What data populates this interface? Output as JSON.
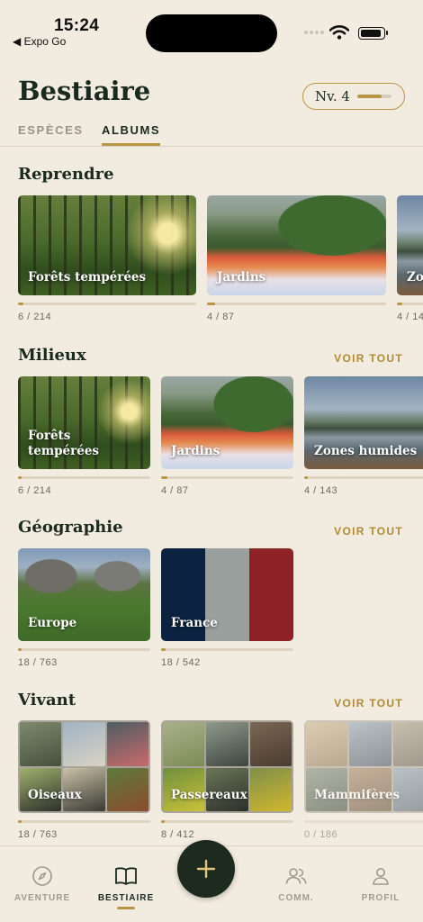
{
  "status": {
    "time": "15:24",
    "back_label": "◀ Expo Go"
  },
  "header": {
    "title": "Bestiaire",
    "level_label": "Nv. 4",
    "level_progress": 0.7
  },
  "tabs": [
    {
      "label": "ESPÈCES"
    },
    {
      "label": "ALBUMS"
    }
  ],
  "sections": {
    "reprendre": {
      "title": "Reprendre",
      "items": [
        {
          "label": "Forêts tempérées",
          "count": "6 / 214",
          "progress": 0.028
        },
        {
          "label": "Jardins",
          "count": "4 / 87",
          "progress": 0.046
        },
        {
          "label": "Zo",
          "count": "4 / 14",
          "progress": 0.028
        }
      ]
    },
    "milieux": {
      "title": "Milieux",
      "see_all": "VOIR TOUT",
      "items": [
        {
          "label": "Forêts tempérées",
          "count": "6 / 214",
          "progress": 0.028
        },
        {
          "label": "Jardins",
          "count": "4 / 87",
          "progress": 0.046
        },
        {
          "label": "Zones humides",
          "count": "4 / 143",
          "progress": 0.028
        }
      ]
    },
    "geographie": {
      "title": "Géographie",
      "see_all": "VOIR TOUT",
      "items": [
        {
          "label": "Europe",
          "count": "18 / 763",
          "progress": 0.024
        },
        {
          "label": "France",
          "count": "18 / 542",
          "progress": 0.033
        }
      ]
    },
    "vivant": {
      "title": "Vivant",
      "see_all": "VOIR TOUT",
      "items": [
        {
          "label": "Oiseaux",
          "count": "18 / 763",
          "progress": 0.024
        },
        {
          "label": "Passereaux",
          "count": "8 / 412",
          "progress": 0.019
        },
        {
          "label": "Mammifères",
          "count": "0 / 186",
          "progress": 0
        }
      ]
    }
  },
  "bottom_nav": [
    {
      "label": "AVENTURE",
      "icon": "compass-icon"
    },
    {
      "label": "BESTIAIRE",
      "icon": "book-icon"
    },
    {
      "label": "COMM.",
      "icon": "users-icon"
    },
    {
      "label": "PROFIL",
      "icon": "user-icon"
    }
  ],
  "colors": {
    "accent": "#b89545",
    "background": "#f2ebdf",
    "dark": "#1c2b1e"
  }
}
